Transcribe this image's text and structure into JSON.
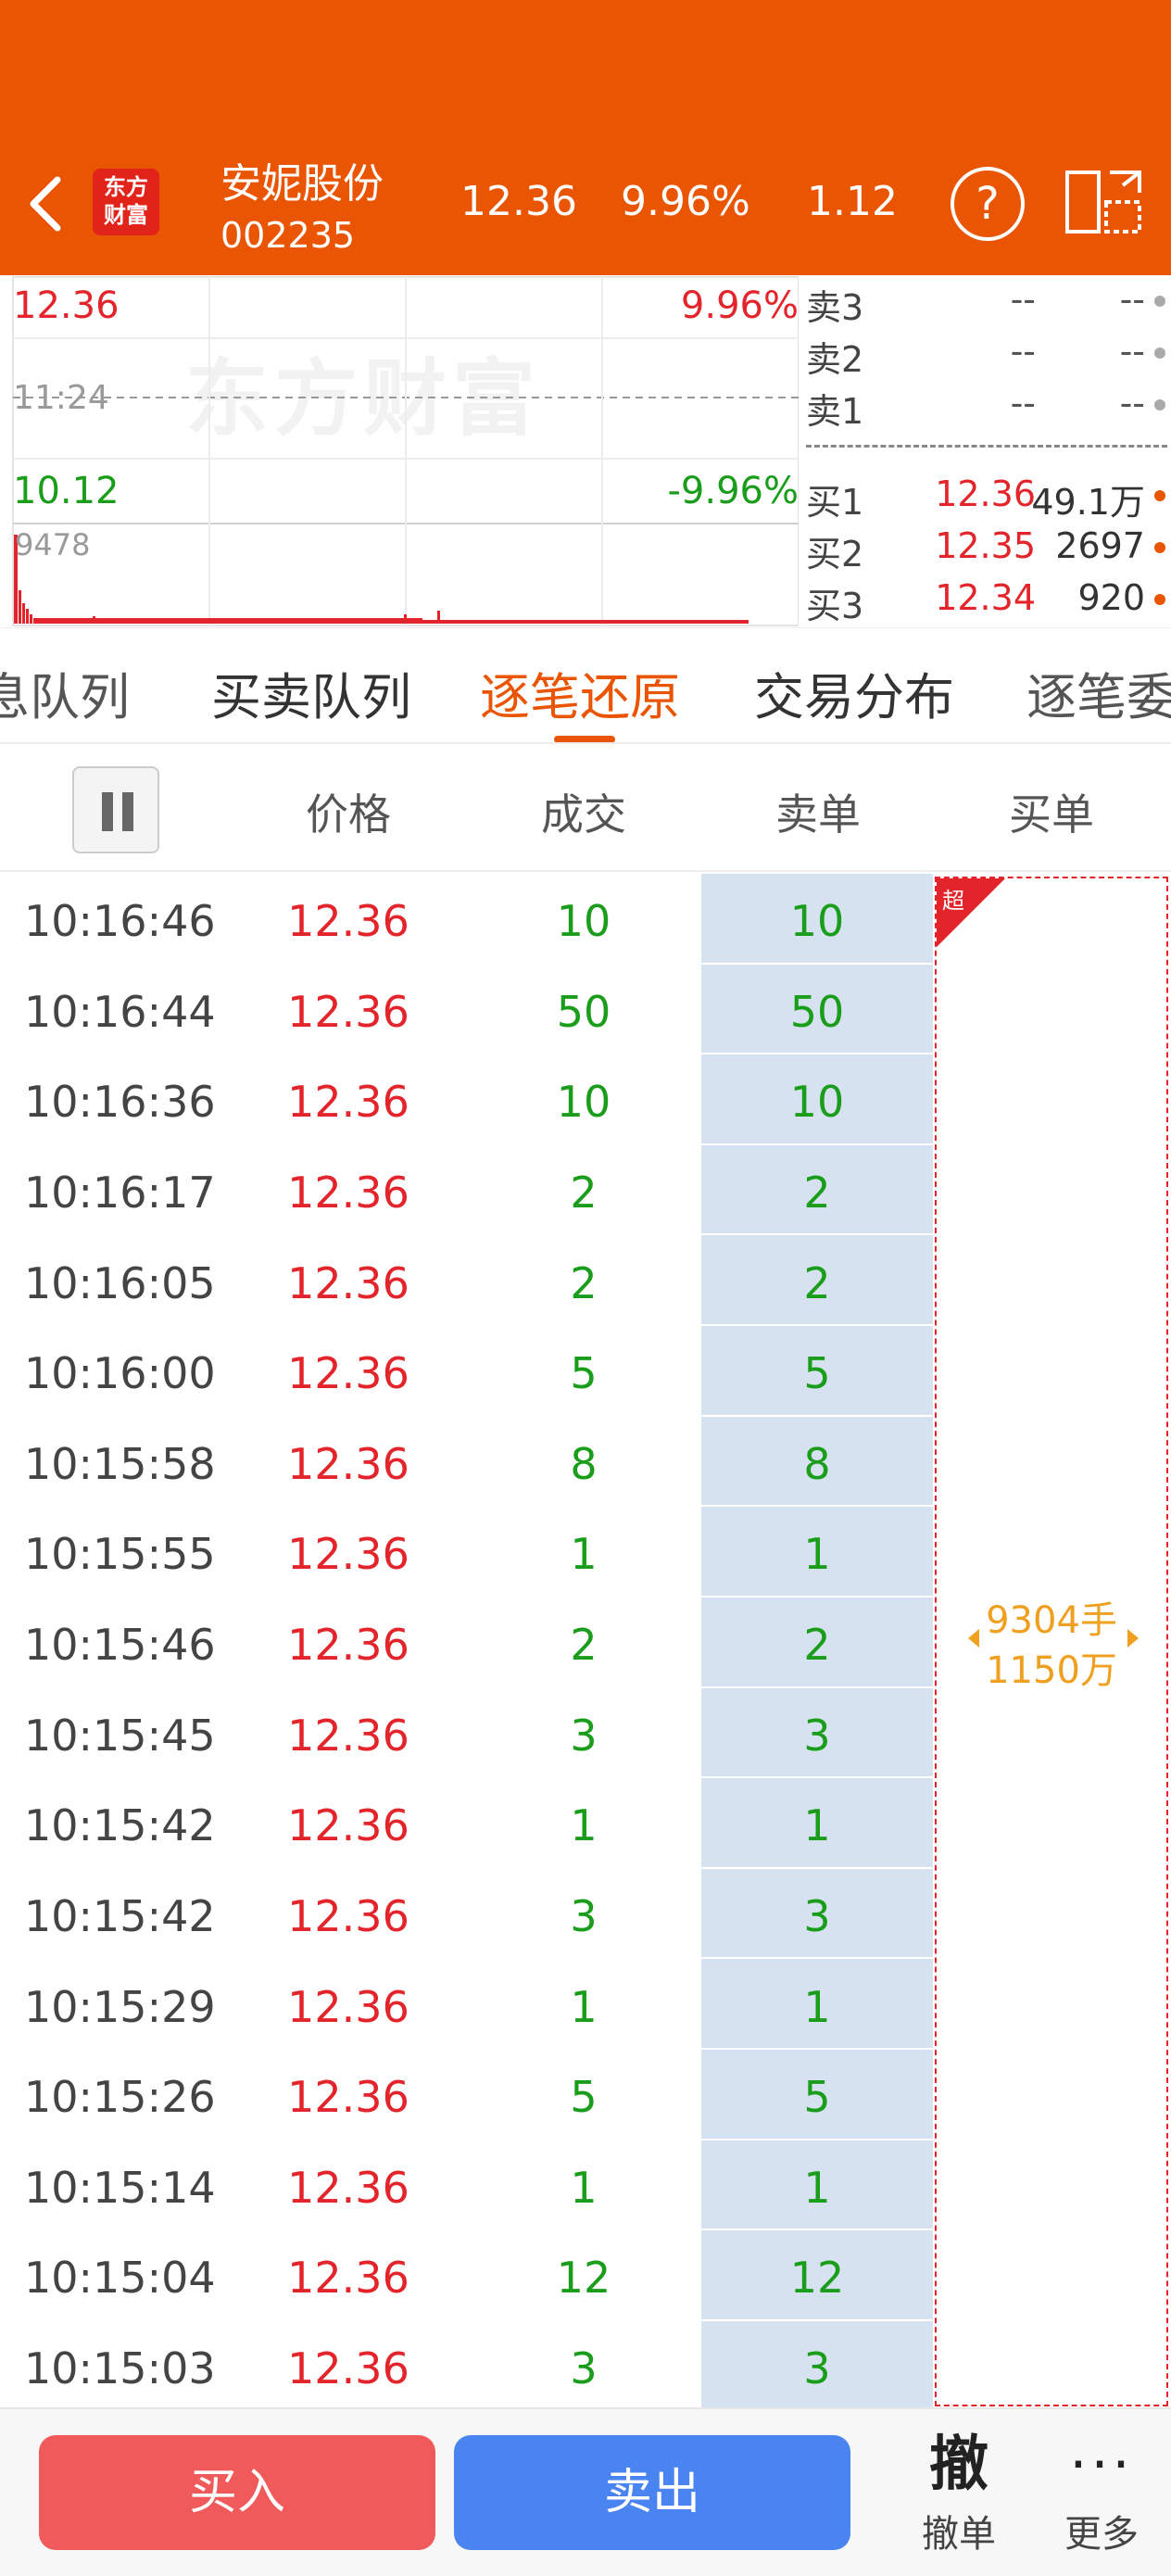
{
  "header": {
    "logo_line1": "东方",
    "logo_line2": "财富",
    "stock_name": "安妮股份",
    "stock_code": "002235",
    "price": "12.36",
    "change_pct": "9.96%",
    "change": "1.12",
    "help_icon": "question-circle-icon",
    "background_color": "#EA5504"
  },
  "mini_chart": {
    "high_price": "12.36",
    "high_pct": "9.96%",
    "mid_time": "11:24",
    "low_price": "10.12",
    "low_pct": "-9.96%",
    "max_volume": "9478",
    "watermark": "东方财富",
    "up_color": "#E3242B",
    "down_color": "#1A9D1A"
  },
  "order_book": {
    "asks": [
      {
        "label": "卖3",
        "price": "--",
        "volume": "--"
      },
      {
        "label": "卖2",
        "price": "--",
        "volume": "--"
      },
      {
        "label": "卖1",
        "price": "--",
        "volume": "--"
      }
    ],
    "bids": [
      {
        "label": "买1",
        "price": "12.36",
        "volume": "49.1万"
      },
      {
        "label": "买2",
        "price": "12.35",
        "volume": "2697"
      },
      {
        "label": "买3",
        "price": "12.34",
        "volume": "920"
      }
    ]
  },
  "tabs": [
    {
      "label": "息队列"
    },
    {
      "label": "买卖队列"
    },
    {
      "label": "逐笔还原",
      "active": true
    },
    {
      "label": "交易分布"
    },
    {
      "label": "逐笔委"
    }
  ],
  "table": {
    "headers": {
      "price": "价格",
      "volume": "成交",
      "sell": "卖单",
      "buy": "买单"
    },
    "rows": [
      {
        "time": "10:16:46",
        "price": "12.36",
        "volume": "10",
        "sell": "10"
      },
      {
        "time": "10:16:44",
        "price": "12.36",
        "volume": "50",
        "sell": "50"
      },
      {
        "time": "10:16:36",
        "price": "12.36",
        "volume": "10",
        "sell": "10"
      },
      {
        "time": "10:16:17",
        "price": "12.36",
        "volume": "2",
        "sell": "2"
      },
      {
        "time": "10:16:05",
        "price": "12.36",
        "volume": "2",
        "sell": "2"
      },
      {
        "time": "10:16:00",
        "price": "12.36",
        "volume": "5",
        "sell": "5"
      },
      {
        "time": "10:15:58",
        "price": "12.36",
        "volume": "8",
        "sell": "8"
      },
      {
        "time": "10:15:55",
        "price": "12.36",
        "volume": "1",
        "sell": "1"
      },
      {
        "time": "10:15:46",
        "price": "12.36",
        "volume": "2",
        "sell": "2"
      },
      {
        "time": "10:15:45",
        "price": "12.36",
        "volume": "3",
        "sell": "3"
      },
      {
        "time": "10:15:42",
        "price": "12.36",
        "volume": "1",
        "sell": "1"
      },
      {
        "time": "10:15:42",
        "price": "12.36",
        "volume": "3",
        "sell": "3"
      },
      {
        "time": "10:15:29",
        "price": "12.36",
        "volume": "1",
        "sell": "1"
      },
      {
        "time": "10:15:26",
        "price": "12.36",
        "volume": "5",
        "sell": "5"
      },
      {
        "time": "10:15:14",
        "price": "12.36",
        "volume": "1",
        "sell": "1"
      },
      {
        "time": "10:15:04",
        "price": "12.36",
        "volume": "12",
        "sell": "12"
      },
      {
        "time": "10:15:03",
        "price": "12.36",
        "volume": "3",
        "sell": "3"
      }
    ],
    "buy_order": {
      "tag": "超",
      "lots": "9304手",
      "amount": "1150万"
    }
  },
  "bottom_bar": {
    "buy_label": "买入",
    "sell_label": "卖出",
    "cancel_icon": "撤",
    "cancel_label": "撤单",
    "more_icon": "···",
    "more_label": "更多"
  }
}
